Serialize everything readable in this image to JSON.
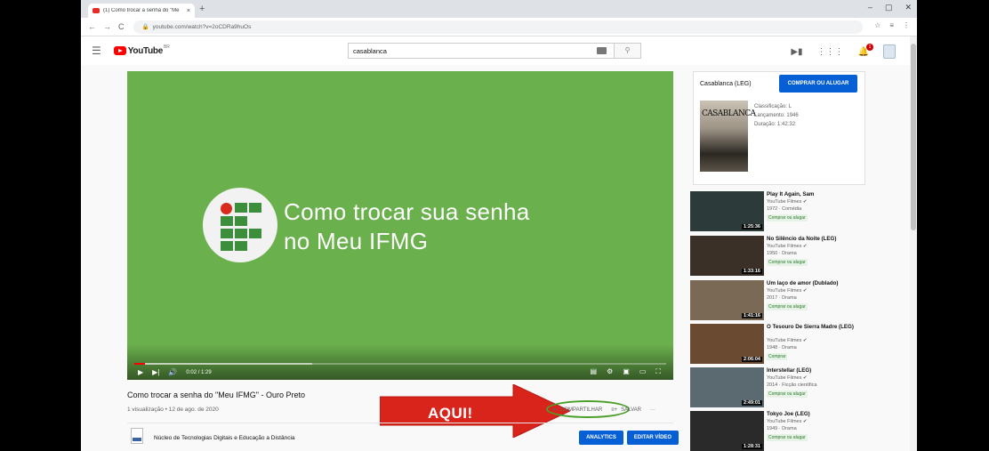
{
  "browser": {
    "tab_title": "(1) Como trocar a senha do \"Me",
    "tab_close": "×",
    "new_tab": "+",
    "window_controls": [
      "–",
      "▢",
      "✕"
    ],
    "url": "youtube.com/watch?v=2oCDRa9huOs",
    "nav": [
      "←",
      "→",
      "C"
    ],
    "addr_icons": [
      "☆",
      "≡",
      "⋮"
    ]
  },
  "header": {
    "logo_word": "YouTube",
    "logo_region": "BR",
    "search_value": "casablanca",
    "search_icon": "search-icon",
    "notifications_count": "1"
  },
  "video": {
    "title_line1": "Como trocar sua senha",
    "title_line2": "no Meu IFMG",
    "time": "0:02 / 1:29",
    "progress": 0.02
  },
  "below": {
    "title": "Como trocar a senha do \"Meu IFMG\" - Ouro Preto",
    "meta": "1 visualização • 12 de ago. de 2020",
    "share_label": "COMPARTILHAR",
    "save_label": "SALVAR",
    "more_label": "···",
    "channel_name": "Núcleo de Tecnologias Digitais e Educação a Distância",
    "analytics_label": "ANALYTICS",
    "edit_label": "EDITAR VÍDEO",
    "annotation": "AQUI!"
  },
  "movie": {
    "title": "Casablanca (LEG)",
    "buy_label": "COMPRAR OU ALUGAR",
    "poster_title": "CASABLANCA",
    "rating": "Classificação: L",
    "release": "Lançamento: 1946",
    "duration": "Duração: 1:42:32"
  },
  "recommendations": [
    {
      "title": "Play It Again, Sam",
      "channel": "YouTube Filmes ✔",
      "meta": "1972 · Comédia",
      "badge": "Comprar ou alugar",
      "duration": "1:25:36"
    },
    {
      "title": "No Silêncio da Noite (LEG)",
      "channel": "YouTube Filmes ✔",
      "meta": "1950 · Drama",
      "badge": "Comprar ou alugar",
      "duration": "1:33:16"
    },
    {
      "title": "Um laço de amor (Dublado)",
      "channel": "YouTube Filmes ✔",
      "meta": "2017 · Drama",
      "badge": "Comprar ou alugar",
      "duration": "1:41:16"
    },
    {
      "title": "O Tesouro De Sierra Madre (LEG)",
      "channel": "YouTube Filmes ✔",
      "meta": "1948 · Drama",
      "badge": "Comprar",
      "duration": "2:06:04"
    },
    {
      "title": "Interstellar (LEG)",
      "channel": "YouTube Filmes ✔",
      "meta": "2014 · Ficção científica",
      "badge": "Comprar ou alugar",
      "duration": "2:49:01"
    },
    {
      "title": "Tokyo Joe (LEG)",
      "channel": "YouTube Filmes ✔",
      "meta": "1949 · Drama",
      "badge": "Comprar ou alugar",
      "duration": "1:28:31"
    }
  ]
}
